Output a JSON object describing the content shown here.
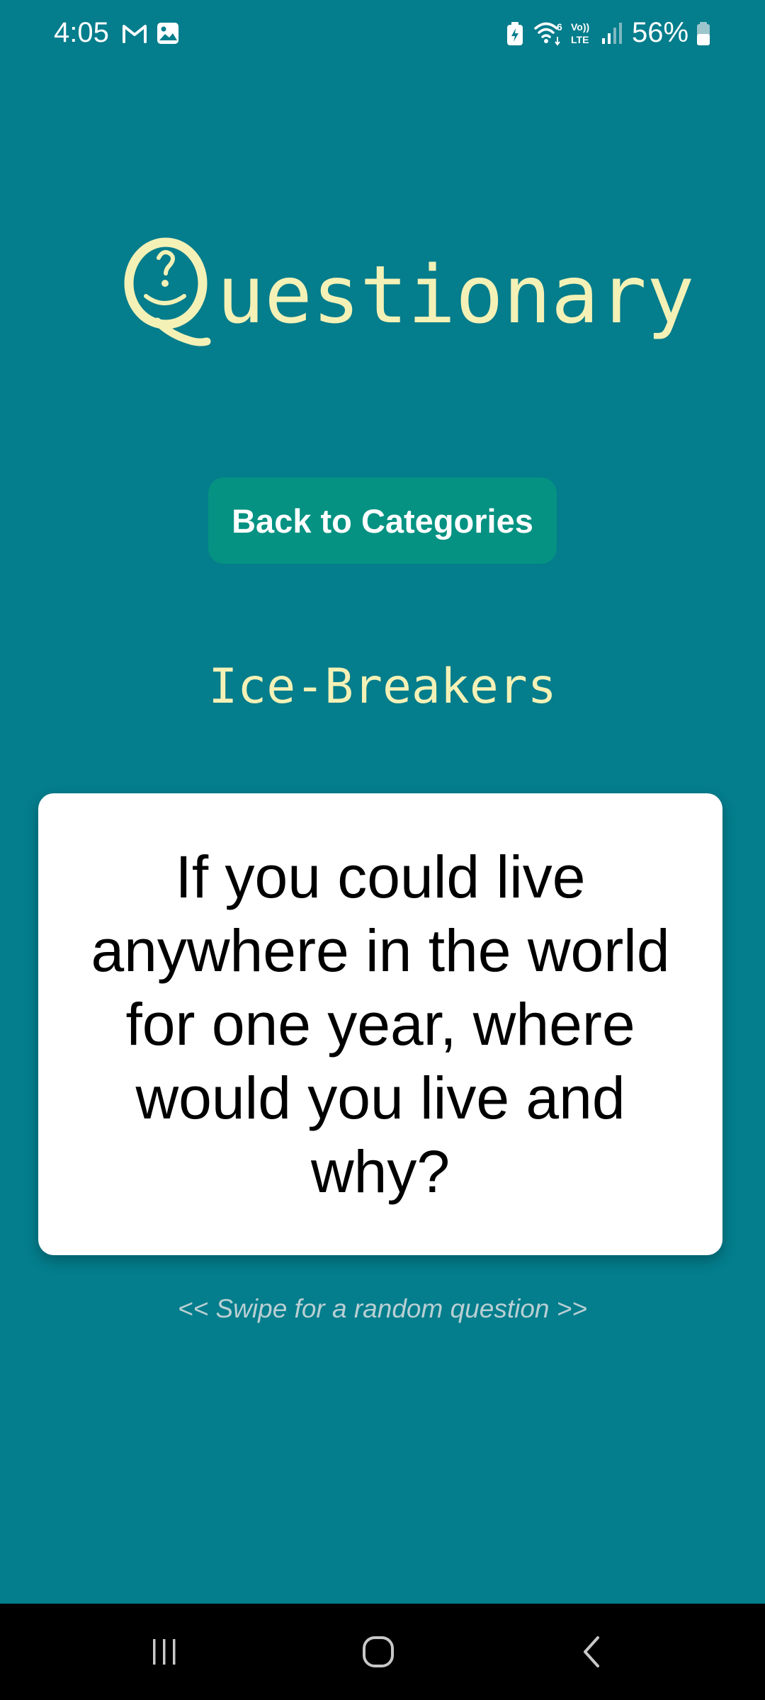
{
  "status_bar": {
    "time": "4:05",
    "battery_percent": "56%",
    "left_icons": [
      "gmail-icon",
      "gallery-icon"
    ],
    "right_icons": [
      "battery-saver-icon",
      "wifi-6-icon",
      "volte-icon",
      "signal-icon",
      "battery-icon"
    ]
  },
  "app": {
    "logo_initial": "Q",
    "logo_rest": "uestionary",
    "logo_color": "#f4f1b6",
    "background_color": "#047d8c"
  },
  "back_button": {
    "label": "Back to Categories",
    "color": "#059282"
  },
  "category": {
    "name": "Ice-Breakers"
  },
  "question": {
    "text": "If you could live anywhere in the world for one year, where would you live and why?"
  },
  "hint": {
    "text": "<< Swipe for a random question >>"
  },
  "nav_bar": {
    "buttons": [
      "recent-apps-icon",
      "home-icon",
      "back-icon"
    ]
  }
}
